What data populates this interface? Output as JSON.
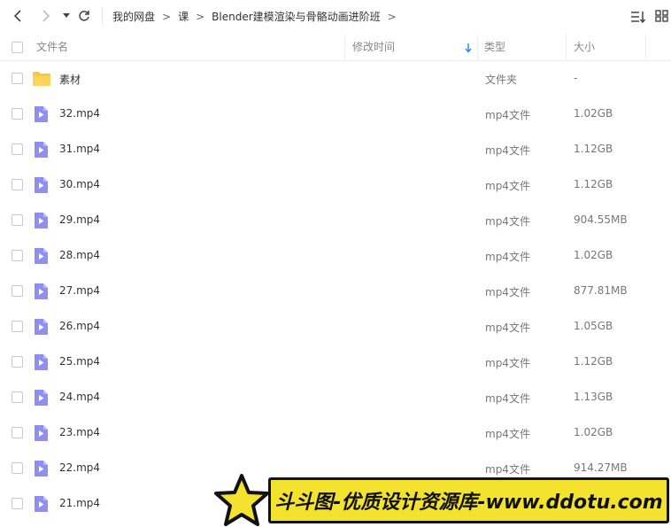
{
  "breadcrumb": {
    "items": [
      "我的网盘",
      "课",
      "Blender建模渲染与骨骼动画进阶班"
    ],
    "separator": ">"
  },
  "header": {
    "name": "文件名",
    "modified": "修改时间",
    "type": "类型",
    "size": "大小"
  },
  "files": [
    {
      "name": "素材",
      "type": "文件夹",
      "size": "-",
      "kind": "folder"
    },
    {
      "name": "32.mp4",
      "type": "mp4文件",
      "size": "1.02GB",
      "kind": "video"
    },
    {
      "name": "31.mp4",
      "type": "mp4文件",
      "size": "1.12GB",
      "kind": "video"
    },
    {
      "name": "30.mp4",
      "type": "mp4文件",
      "size": "1.12GB",
      "kind": "video"
    },
    {
      "name": "29.mp4",
      "type": "mp4文件",
      "size": "904.55MB",
      "kind": "video"
    },
    {
      "name": "28.mp4",
      "type": "mp4文件",
      "size": "1.02GB",
      "kind": "video"
    },
    {
      "name": "27.mp4",
      "type": "mp4文件",
      "size": "877.81MB",
      "kind": "video"
    },
    {
      "name": "26.mp4",
      "type": "mp4文件",
      "size": "1.05GB",
      "kind": "video"
    },
    {
      "name": "25.mp4",
      "type": "mp4文件",
      "size": "1.12GB",
      "kind": "video"
    },
    {
      "name": "24.mp4",
      "type": "mp4文件",
      "size": "1.13GB",
      "kind": "video"
    },
    {
      "name": "23.mp4",
      "type": "mp4文件",
      "size": "1.02GB",
      "kind": "video"
    },
    {
      "name": "22.mp4",
      "type": "mp4文件",
      "size": "914.27MB",
      "kind": "video"
    },
    {
      "name": "21.mp4",
      "type": "",
      "size": "",
      "kind": "video"
    }
  ],
  "watermark": {
    "text": "斗斗图-优质设计资源库-www.ddotu.com"
  },
  "colors": {
    "folder": "#f9c83c",
    "video": "#8e8ff0",
    "sort_arrow": "#2f8cf0",
    "watermark_bg": "#f3e32e"
  },
  "icons": {
    "back": "chevron-left-icon",
    "forward": "chevron-right-icon",
    "history": "caret-down-icon",
    "refresh": "refresh-icon",
    "sort": "sort-icon",
    "view": "grid-view-icon"
  }
}
